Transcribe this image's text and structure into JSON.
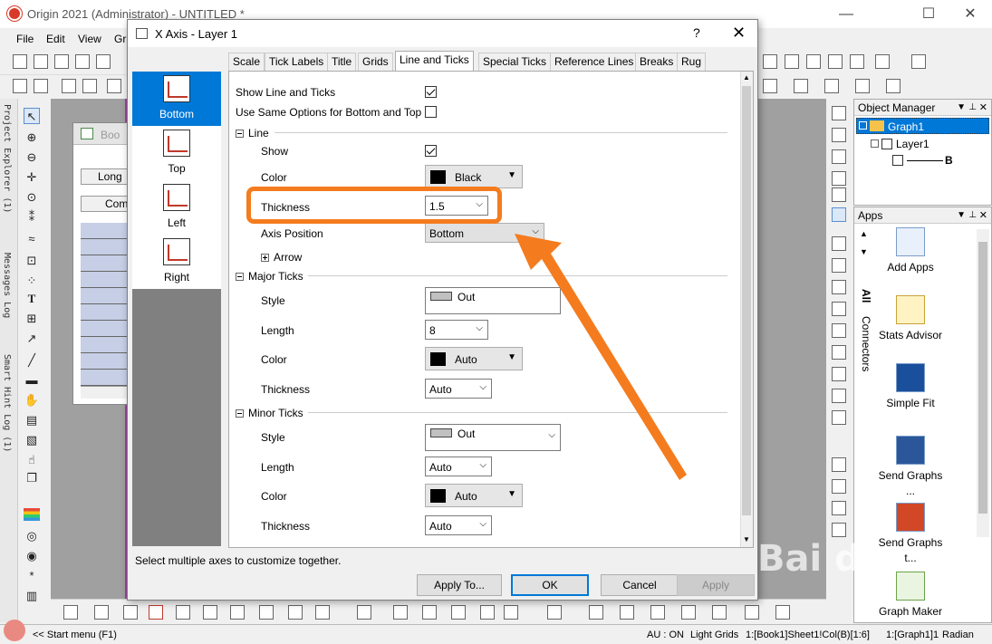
{
  "app": {
    "title": "Origin 2021 (Administrator) - UNTITLED *",
    "menus": [
      "File",
      "Edit",
      "View",
      "Gr"
    ],
    "minimize": "—",
    "maximize": "☐",
    "close": "✕"
  },
  "left_dock": {
    "tabs": [
      "Project Explorer (1)",
      "Messages Log",
      "Smart Hint Log (1)"
    ]
  },
  "book": {
    "title": "Boo",
    "rows": [
      "Long",
      "Com"
    ]
  },
  "object_manager": {
    "title": "Object Manager",
    "tree": [
      {
        "label": "Graph1",
        "level": 0,
        "selected": true
      },
      {
        "label": "Layer1",
        "level": 1
      },
      {
        "label": "B",
        "level": 2
      }
    ]
  },
  "apps_panel": {
    "title": "Apps",
    "side_tabs": [
      "All",
      "Connectors"
    ],
    "items": [
      {
        "label": "Add Apps"
      },
      {
        "label": "Stats Advisor"
      },
      {
        "label": "Simple Fit"
      },
      {
        "label": "Send Graphs ..."
      },
      {
        "label": "Send Graphs t..."
      },
      {
        "label": "Graph Maker"
      }
    ]
  },
  "statusbar": {
    "start_menu": "<< Start menu (F1)",
    "au": "AU : ON",
    "light_grids": "Light Grids",
    "col": "1:[Book1]Sheet1!Col(B)[1:6]",
    "graph": "1:[Graph1]1",
    "unit": "Radian"
  },
  "dialog": {
    "title": "X Axis - Layer 1",
    "help": "?",
    "close": "✕",
    "axes": [
      {
        "label": "Bottom",
        "selected": true
      },
      {
        "label": "Top",
        "selected": false
      },
      {
        "label": "Left",
        "selected": false
      },
      {
        "label": "Right",
        "selected": false
      }
    ],
    "tabs": [
      {
        "label": "Scale",
        "active": false
      },
      {
        "label": "Tick Labels",
        "active": false
      },
      {
        "label": "Title",
        "active": false
      },
      {
        "label": "Grids",
        "active": false
      },
      {
        "label": "Line and Ticks",
        "active": true
      },
      {
        "label": "Special Ticks",
        "active": false
      },
      {
        "label": "Reference Lines",
        "active": false
      },
      {
        "label": "Breaks",
        "active": false
      },
      {
        "label": "Rug",
        "active": false
      }
    ],
    "options": {
      "show_line_and_ticks": {
        "label": "Show Line and Ticks",
        "checked": true
      },
      "use_same_options": {
        "label": "Use Same Options for Bottom and Top",
        "checked": false
      }
    },
    "line": {
      "header": "Line",
      "show": {
        "label": "Show",
        "checked": true
      },
      "color": {
        "label": "Color",
        "value": "Black",
        "swatch": "#000000"
      },
      "thickness": {
        "label": "Thickness",
        "value": "1.5"
      },
      "axis_position": {
        "label": "Axis Position",
        "value": "Bottom"
      },
      "arrow": {
        "label": "Arrow"
      }
    },
    "major_ticks": {
      "header": "Major Ticks",
      "style": {
        "label": "Style",
        "value": "Out"
      },
      "length": {
        "label": "Length",
        "value": "8"
      },
      "color": {
        "label": "Color",
        "value": "Auto",
        "swatch": "#000000"
      },
      "thickness": {
        "label": "Thickness",
        "value": "Auto"
      }
    },
    "minor_ticks": {
      "header": "Minor Ticks",
      "style": {
        "label": "Style",
        "value": "Out"
      },
      "length": {
        "label": "Length",
        "value": "Auto"
      },
      "color": {
        "label": "Color",
        "value": "Auto",
        "swatch": "#000000"
      },
      "thickness": {
        "label": "Thickness",
        "value": "Auto"
      }
    },
    "hint": "Select multiple axes to customize together.",
    "buttons": {
      "apply_to": "Apply To...",
      "ok": "OK",
      "cancel": "Cancel",
      "apply": "Apply"
    }
  },
  "annotation": {
    "highlight_color": "#f47c1f",
    "watermark": "Bai du"
  }
}
